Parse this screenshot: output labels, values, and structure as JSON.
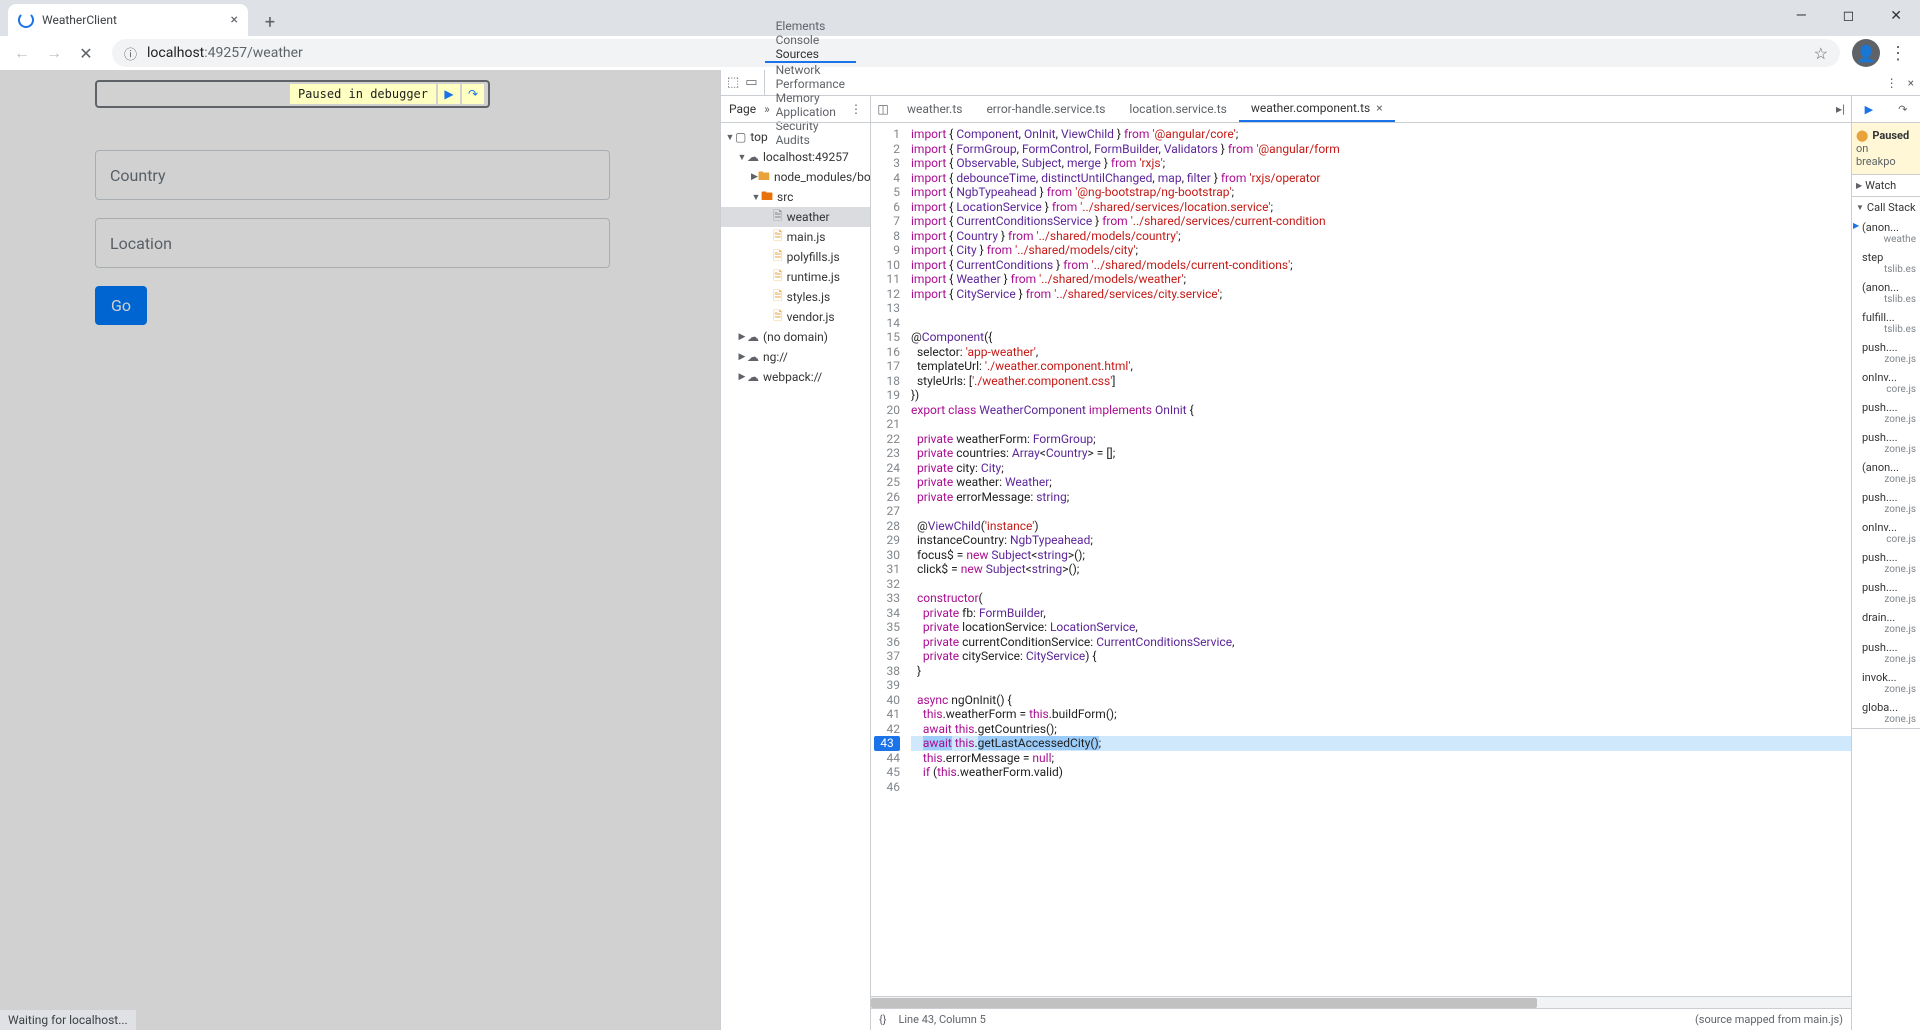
{
  "browser": {
    "tab_title": "WeatherClient",
    "url_host": "localhost",
    "url_port": ":49257",
    "url_path": "/weather",
    "info_icon": "ⓘ",
    "status_text": "Waiting for localhost..."
  },
  "page": {
    "country_placeholder": "Country",
    "location_placeholder": "Location",
    "go_label": "Go"
  },
  "debug_overlay": {
    "label": "Paused in debugger"
  },
  "devtools": {
    "tabs": [
      "Elements",
      "Console",
      "Sources",
      "Network",
      "Performance",
      "Memory",
      "Application",
      "Security",
      "Audits"
    ],
    "active_tab": "Sources"
  },
  "navigator": {
    "header": "Page",
    "tree": {
      "top": "top",
      "host": "localhost:49257",
      "node_modules": "node_modules/bo",
      "src": "src",
      "weather_file": "weather",
      "files": [
        "main.js",
        "polyfills.js",
        "runtime.js",
        "styles.js",
        "vendor.js"
      ],
      "no_domain": "(no domain)",
      "ng": "ng://",
      "webpack": "webpack://"
    }
  },
  "editor": {
    "tabs": [
      "weather.ts",
      "error-handle.service.ts",
      "location.service.ts",
      "weather.component.ts"
    ],
    "active_tab": "weather.component.ts",
    "breakpoint_line": 43,
    "status_left": "{}",
    "status_cursor": "Line 43, Column 5",
    "status_right": "(source mapped from main.js)"
  },
  "code": {
    "lines": [
      {
        "n": 1,
        "h": "<span class=kw>import</span> { <span class=id>Component</span>, <span class=id>OnInit</span>, <span class=id>ViewChild</span> } <span class=kw>from</span> <span class=str>'@angular/core'</span>;"
      },
      {
        "n": 2,
        "h": "<span class=kw>import</span> { <span class=id>FormGroup</span>, <span class=id>FormControl</span>, <span class=id>FormBuilder</span>, <span class=id>Validators</span> } <span class=kw>from</span> <span class=str>'@angular/form</span>"
      },
      {
        "n": 3,
        "h": "<span class=kw>import</span> { <span class=id>Observable</span>, <span class=id>Subject</span>, <span class=id>merge</span> } <span class=kw>from</span> <span class=str>'rxjs'</span>;"
      },
      {
        "n": 4,
        "h": "<span class=kw>import</span> { <span class=id>debounceTime</span>, <span class=id>distinctUntilChanged</span>, <span class=id>map</span>, <span class=id>filter</span> } <span class=kw>from</span> <span class=str>'rxjs/operator</span>"
      },
      {
        "n": 5,
        "h": "<span class=kw>import</span> { <span class=id>NgbTypeahead</span> } <span class=kw>from</span> <span class=str>'@ng-bootstrap/ng-bootstrap'</span>;"
      },
      {
        "n": 6,
        "h": "<span class=kw>import</span> { <span class=id>LocationService</span> } <span class=kw>from</span> <span class=str>'../shared/services/location.service'</span>;"
      },
      {
        "n": 7,
        "h": "<span class=kw>import</span> { <span class=id>CurrentConditionsService</span> } <span class=kw>from</span> <span class=str>'../shared/services/current-condition</span>"
      },
      {
        "n": 8,
        "h": "<span class=kw>import</span> { <span class=id>Country</span> } <span class=kw>from</span> <span class=str>'../shared/models/country'</span>;"
      },
      {
        "n": 9,
        "h": "<span class=kw>import</span> { <span class=id>City</span> } <span class=kw>from</span> <span class=str>'../shared/models/city'</span>;"
      },
      {
        "n": 10,
        "h": "<span class=kw>import</span> { <span class=id>CurrentConditions</span> } <span class=kw>from</span> <span class=str>'../shared/models/current-conditions'</span>;"
      },
      {
        "n": 11,
        "h": "<span class=kw>import</span> { <span class=id>Weather</span> } <span class=kw>from</span> <span class=str>'../shared/models/weather'</span>;"
      },
      {
        "n": 12,
        "h": "<span class=kw>import</span> { <span class=id>CityService</span> } <span class=kw>from</span> <span class=str>'../shared/services/city.service'</span>;"
      },
      {
        "n": 13,
        "h": ""
      },
      {
        "n": 14,
        "h": ""
      },
      {
        "n": 15,
        "h": "@<span class=id>Component</span>({"
      },
      {
        "n": 16,
        "h": "  selector: <span class=str>'app-weather'</span>,"
      },
      {
        "n": 17,
        "h": "  templateUrl: <span class=str>'./weather.component.html'</span>,"
      },
      {
        "n": 18,
        "h": "  styleUrls: [<span class=str>'./weather.component.css'</span>]"
      },
      {
        "n": 19,
        "h": "})"
      },
      {
        "n": 20,
        "h": "<span class=kw>export</span> <span class=kw>class</span> <span class=id>WeatherComponent</span> <span class=kw>implements</span> <span class=id>OnInit</span> {"
      },
      {
        "n": 21,
        "h": ""
      },
      {
        "n": 22,
        "h": "  <span class=kw>private</span> weatherForm: <span class=id>FormGroup</span>;"
      },
      {
        "n": 23,
        "h": "  <span class=kw>private</span> countries: <span class=id>Array</span>&lt;<span class=id>Country</span>&gt; = [];"
      },
      {
        "n": 24,
        "h": "  <span class=kw>private</span> city: <span class=id>City</span>;"
      },
      {
        "n": 25,
        "h": "  <span class=kw>private</span> weather: <span class=id>Weather</span>;"
      },
      {
        "n": 26,
        "h": "  <span class=kw>private</span> errorMessage: <span class=id>string</span>;"
      },
      {
        "n": 27,
        "h": ""
      },
      {
        "n": 28,
        "h": "  @<span class=id>ViewChild</span>(<span class=str>'instance'</span>)"
      },
      {
        "n": 29,
        "h": "  instanceCountry: <span class=id>NgbTypeahead</span>;"
      },
      {
        "n": 30,
        "h": "  focus$ = <span class=kw>new</span> <span class=id>Subject</span>&lt;<span class=id>string</span>&gt;();"
      },
      {
        "n": 31,
        "h": "  click$ = <span class=kw>new</span> <span class=id>Subject</span>&lt;<span class=id>string</span>&gt;();"
      },
      {
        "n": 32,
        "h": ""
      },
      {
        "n": 33,
        "h": "  <span class=kw>constructor</span>("
      },
      {
        "n": 34,
        "h": "    <span class=kw>private</span> fb: <span class=id>FormBuilder</span>,"
      },
      {
        "n": 35,
        "h": "    <span class=kw>private</span> locationService: <span class=id>LocationService</span>,"
      },
      {
        "n": 36,
        "h": "    <span class=kw>private</span> currentConditionService: <span class=id>CurrentConditionsService</span>,"
      },
      {
        "n": 37,
        "h": "    <span class=kw>private</span> cityService: <span class=id>CityService</span>) {"
      },
      {
        "n": 38,
        "h": "  }"
      },
      {
        "n": 39,
        "h": ""
      },
      {
        "n": 40,
        "h": "  <span class=kw>async</span> ngOnInit() {"
      },
      {
        "n": 41,
        "h": "    <span class=kw>this</span>.weatherForm = <span class=kw>this</span>.buildForm();"
      },
      {
        "n": 42,
        "h": "    <span class=kw>await</span> <span class=kw>this</span>.getCountries();"
      },
      {
        "n": 43,
        "h": "    <span class=hl-exec><span class=kw>await</span></span> <span class=kw>this</span>.<span class=hl-exec>getLastAccessedCity()</span>;",
        "hl": true
      },
      {
        "n": 44,
        "h": "    <span class=kw>this</span>.errorMessage = <span class=kw>null</span>;"
      },
      {
        "n": 45,
        "h": "    <span class=kw>if</span> (<span class=kw>this</span>.weatherForm.valid)"
      },
      {
        "n": 46,
        "h": ""
      }
    ]
  },
  "paused_banner": {
    "title": "Paused",
    "line2": "on",
    "line3": "breakpo"
  },
  "watch_label": "Watch",
  "callstack_label": "Call Stack",
  "callstack": [
    {
      "fn": "(anon...",
      "src": "weathe"
    },
    {
      "fn": "step",
      "src": "tslib.es"
    },
    {
      "fn": "(anon...",
      "src": "tslib.es"
    },
    {
      "fn": "fulfill...",
      "src": "tslib.es"
    },
    {
      "fn": "push....",
      "src": "zone.js"
    },
    {
      "fn": "onInv...",
      "src": "core.js"
    },
    {
      "fn": "push....",
      "src": "zone.js"
    },
    {
      "fn": "push....",
      "src": "zone.js"
    },
    {
      "fn": "(anon...",
      "src": "zone.js"
    },
    {
      "fn": "push....",
      "src": "zone.js"
    },
    {
      "fn": "onInv...",
      "src": "core.js"
    },
    {
      "fn": "push....",
      "src": "zone.js"
    },
    {
      "fn": "push....",
      "src": "zone.js"
    },
    {
      "fn": "drain...",
      "src": "zone.js"
    },
    {
      "fn": "push....",
      "src": "zone.js"
    },
    {
      "fn": "invok...",
      "src": "zone.js"
    },
    {
      "fn": "globa...",
      "src": "zone.js"
    }
  ]
}
